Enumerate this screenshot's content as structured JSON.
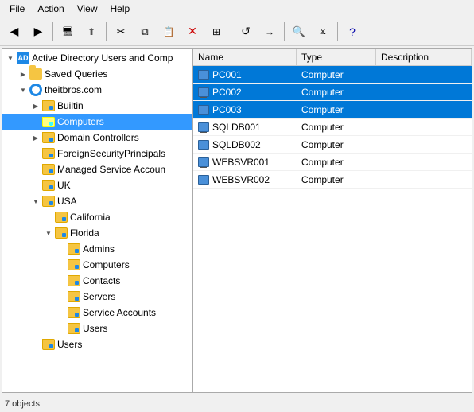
{
  "menubar": {
    "items": [
      "File",
      "Action",
      "View",
      "Help"
    ]
  },
  "toolbar": {
    "buttons": [
      {
        "name": "back-btn",
        "icon": "◀",
        "tooltip": "Back"
      },
      {
        "name": "forward-btn",
        "icon": "▶",
        "tooltip": "Forward"
      },
      {
        "name": "up-btn",
        "icon": "📁",
        "tooltip": "Up"
      },
      {
        "name": "show-hide-btn",
        "icon": "🖥",
        "tooltip": "Show/Hide"
      },
      {
        "name": "cut-btn",
        "icon": "✂",
        "tooltip": "Cut"
      },
      {
        "name": "copy-btn",
        "icon": "⧉",
        "tooltip": "Copy"
      },
      {
        "name": "paste-btn",
        "icon": "📋",
        "tooltip": "Paste"
      },
      {
        "name": "delete-btn",
        "icon": "✕",
        "tooltip": "Delete"
      },
      {
        "name": "properties-btn",
        "icon": "⊞",
        "tooltip": "Properties"
      },
      {
        "name": "refresh-btn",
        "icon": "↺",
        "tooltip": "Refresh"
      },
      {
        "name": "export-btn",
        "icon": "→",
        "tooltip": "Export"
      },
      {
        "name": "filter-btn",
        "icon": "⧖",
        "tooltip": "Filter"
      },
      {
        "name": "help-btn",
        "icon": "?",
        "tooltip": "Help"
      }
    ]
  },
  "tree": {
    "root_label": "Active Directory Users and Comp",
    "items": [
      {
        "id": "saved-queries",
        "label": "Saved Queries",
        "indent": 1,
        "icon": "folder",
        "expanded": false
      },
      {
        "id": "theitbros",
        "label": "theitbros.com",
        "indent": 1,
        "icon": "ad",
        "expanded": true
      },
      {
        "id": "builtin",
        "label": "Builtin",
        "indent": 2,
        "icon": "ou",
        "expanded": false
      },
      {
        "id": "computers",
        "label": "Computers",
        "indent": 2,
        "icon": "ou-folder",
        "expanded": false,
        "selected": true
      },
      {
        "id": "domain-controllers",
        "label": "Domain Controllers",
        "indent": 2,
        "icon": "ou",
        "expanded": false
      },
      {
        "id": "foreign-security",
        "label": "ForeignSecurityPrincipals",
        "indent": 2,
        "icon": "ou",
        "expanded": false
      },
      {
        "id": "managed-service",
        "label": "Managed Service Accoun",
        "indent": 2,
        "icon": "ou",
        "expanded": false
      },
      {
        "id": "uk",
        "label": "UK",
        "indent": 2,
        "icon": "ou",
        "expanded": false
      },
      {
        "id": "usa",
        "label": "USA",
        "indent": 2,
        "icon": "ou",
        "expanded": true
      },
      {
        "id": "california",
        "label": "California",
        "indent": 3,
        "icon": "ou",
        "expanded": false
      },
      {
        "id": "florida",
        "label": "Florida",
        "indent": 3,
        "icon": "ou",
        "expanded": true
      },
      {
        "id": "admins",
        "label": "Admins",
        "indent": 4,
        "icon": "ou",
        "expanded": false
      },
      {
        "id": "computers-fl",
        "label": "Computers",
        "indent": 4,
        "icon": "ou",
        "expanded": false
      },
      {
        "id": "contacts",
        "label": "Contacts",
        "indent": 4,
        "icon": "ou",
        "expanded": false
      },
      {
        "id": "servers",
        "label": "Servers",
        "indent": 4,
        "icon": "ou",
        "expanded": false
      },
      {
        "id": "service-accounts",
        "label": "Service Accounts",
        "indent": 4,
        "icon": "ou",
        "expanded": false
      },
      {
        "id": "users-fl",
        "label": "Users",
        "indent": 4,
        "icon": "ou",
        "expanded": false
      },
      {
        "id": "users-root",
        "label": "Users",
        "indent": 2,
        "icon": "ou",
        "expanded": false
      }
    ]
  },
  "list": {
    "columns": [
      {
        "id": "name",
        "label": "Name"
      },
      {
        "id": "type",
        "label": "Type"
      },
      {
        "id": "description",
        "label": "Description"
      }
    ],
    "rows": [
      {
        "name": "PC001",
        "type": "Computer",
        "description": "",
        "selected": true
      },
      {
        "name": "PC002",
        "type": "Computer",
        "description": "",
        "selected": true
      },
      {
        "name": "PC003",
        "type": "Computer",
        "description": "",
        "selected": true
      },
      {
        "name": "SQLDB001",
        "type": "Computer",
        "description": "",
        "selected": false
      },
      {
        "name": "SQLDB002",
        "type": "Computer",
        "description": "",
        "selected": false
      },
      {
        "name": "WEBSVR001",
        "type": "Computer",
        "description": "",
        "selected": false
      },
      {
        "name": "WEBSVR002",
        "type": "Computer",
        "description": "",
        "selected": false
      }
    ]
  },
  "statusbar": {
    "text": "7 objects"
  }
}
